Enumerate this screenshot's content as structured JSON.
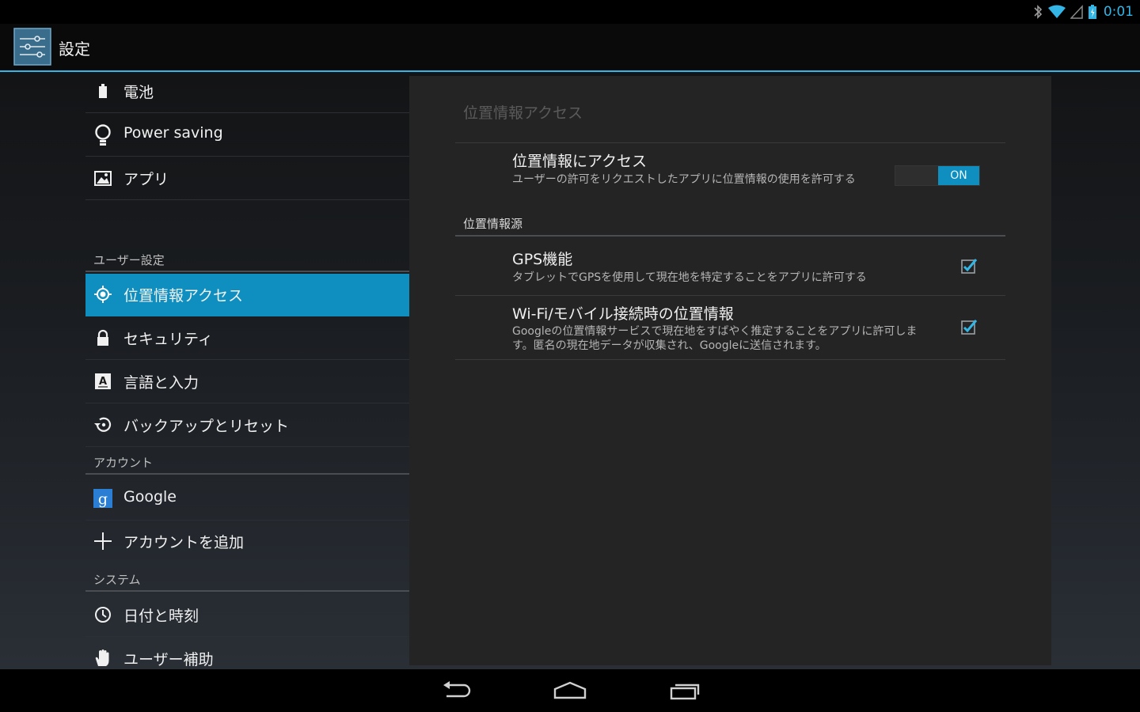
{
  "status_bar": {
    "time": "0:01"
  },
  "action_bar": {
    "title": "設定"
  },
  "sidebar": {
    "items_top": [
      {
        "label": "電池",
        "icon": "battery-icon"
      },
      {
        "label": "Power saving",
        "icon": "lightbulb-icon"
      },
      {
        "label": "アプリ",
        "icon": "apps-icon"
      }
    ],
    "user_header": "ユーザー設定",
    "user_items": [
      {
        "label": "位置情報アクセス",
        "icon": "location-icon",
        "selected": true
      },
      {
        "label": "セキュリティ",
        "icon": "lock-icon"
      },
      {
        "label": "言語と入力",
        "icon": "language-icon"
      },
      {
        "label": "バックアップとリセット",
        "icon": "backup-icon"
      }
    ],
    "account_header": "アカウント",
    "account_items": [
      {
        "label": "Google",
        "icon": "google-icon"
      },
      {
        "label": "アカウントを追加",
        "icon": "plus-icon"
      }
    ],
    "system_header": "システム",
    "system_items": [
      {
        "label": "日付と時刻",
        "icon": "clock-icon"
      },
      {
        "label": "ユーザー補助",
        "icon": "hand-icon"
      }
    ]
  },
  "panel": {
    "title": "位置情報アクセス",
    "access": {
      "title": "位置情報にアクセス",
      "summary": "ユーザーの許可をリクエストしたアプリに位置情報の使用を許可する",
      "toggle_label": "ON"
    },
    "section": "位置情報源",
    "gps": {
      "title": "GPS機能",
      "summary": "タブレットでGPSを使用して現在地を特定することをアプリに許可する",
      "checked": true
    },
    "wifi": {
      "title": "Wi-Fi/モバイル接続時の位置情報",
      "summary": "Googleの位置情報サービスで現在地をすばやく推定することをアプリに許可します。匿名の現在地データが収集され、Googleに送信されます。",
      "checked": true
    }
  },
  "colors": {
    "accent": "#33b5e5",
    "selected": "#0f8fbf"
  }
}
